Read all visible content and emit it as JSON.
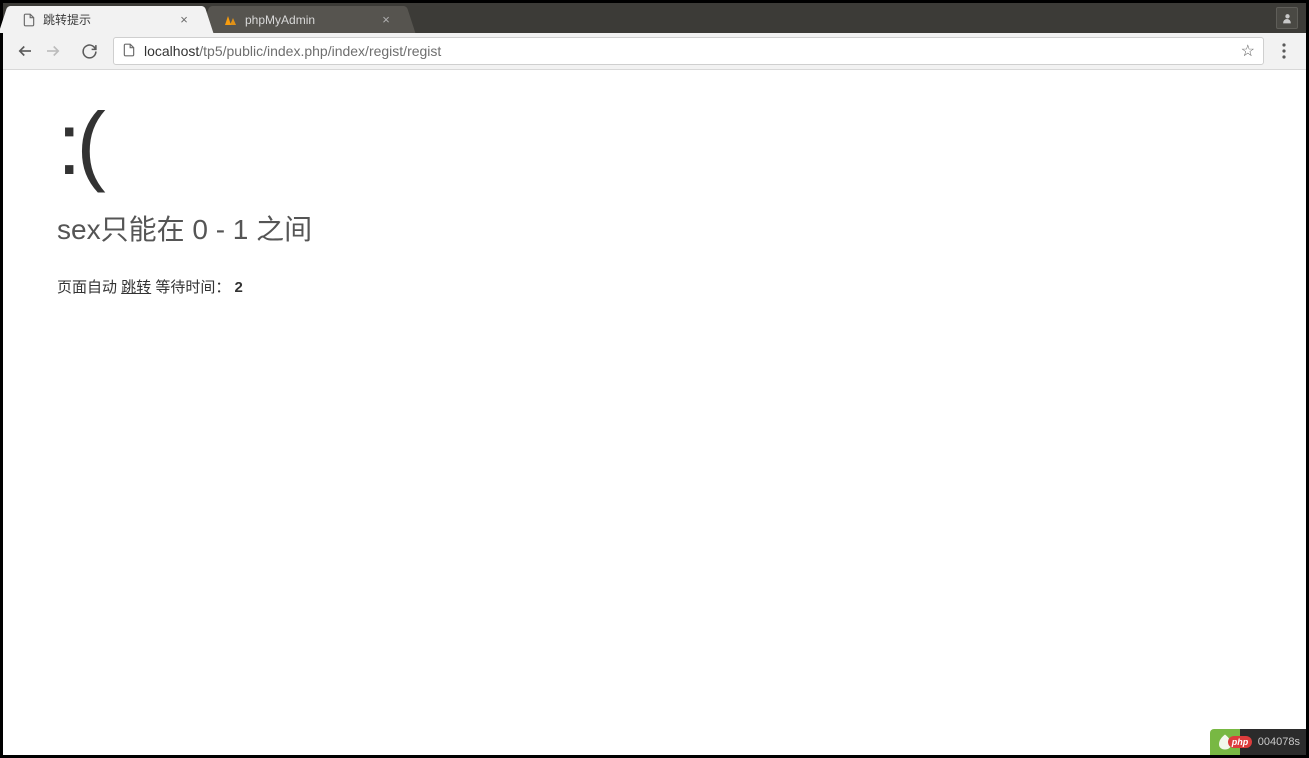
{
  "tabs": [
    {
      "title": "跳转提示",
      "active": true
    },
    {
      "title": "phpMyAdmin",
      "active": false
    }
  ],
  "addressBar": {
    "host": "localhost",
    "path": "/tp5/public/index.php/index/regist/regist"
  },
  "page": {
    "face": ":(",
    "errorMessage": "sex只能在 0 - 1 之间",
    "redirect": {
      "prefix": "页面自动 ",
      "linkText": "跳转",
      "waitLabel": " 等待时间： ",
      "seconds": "2"
    }
  },
  "watermark": {
    "phpLabel": "php",
    "timing": "004078s"
  }
}
